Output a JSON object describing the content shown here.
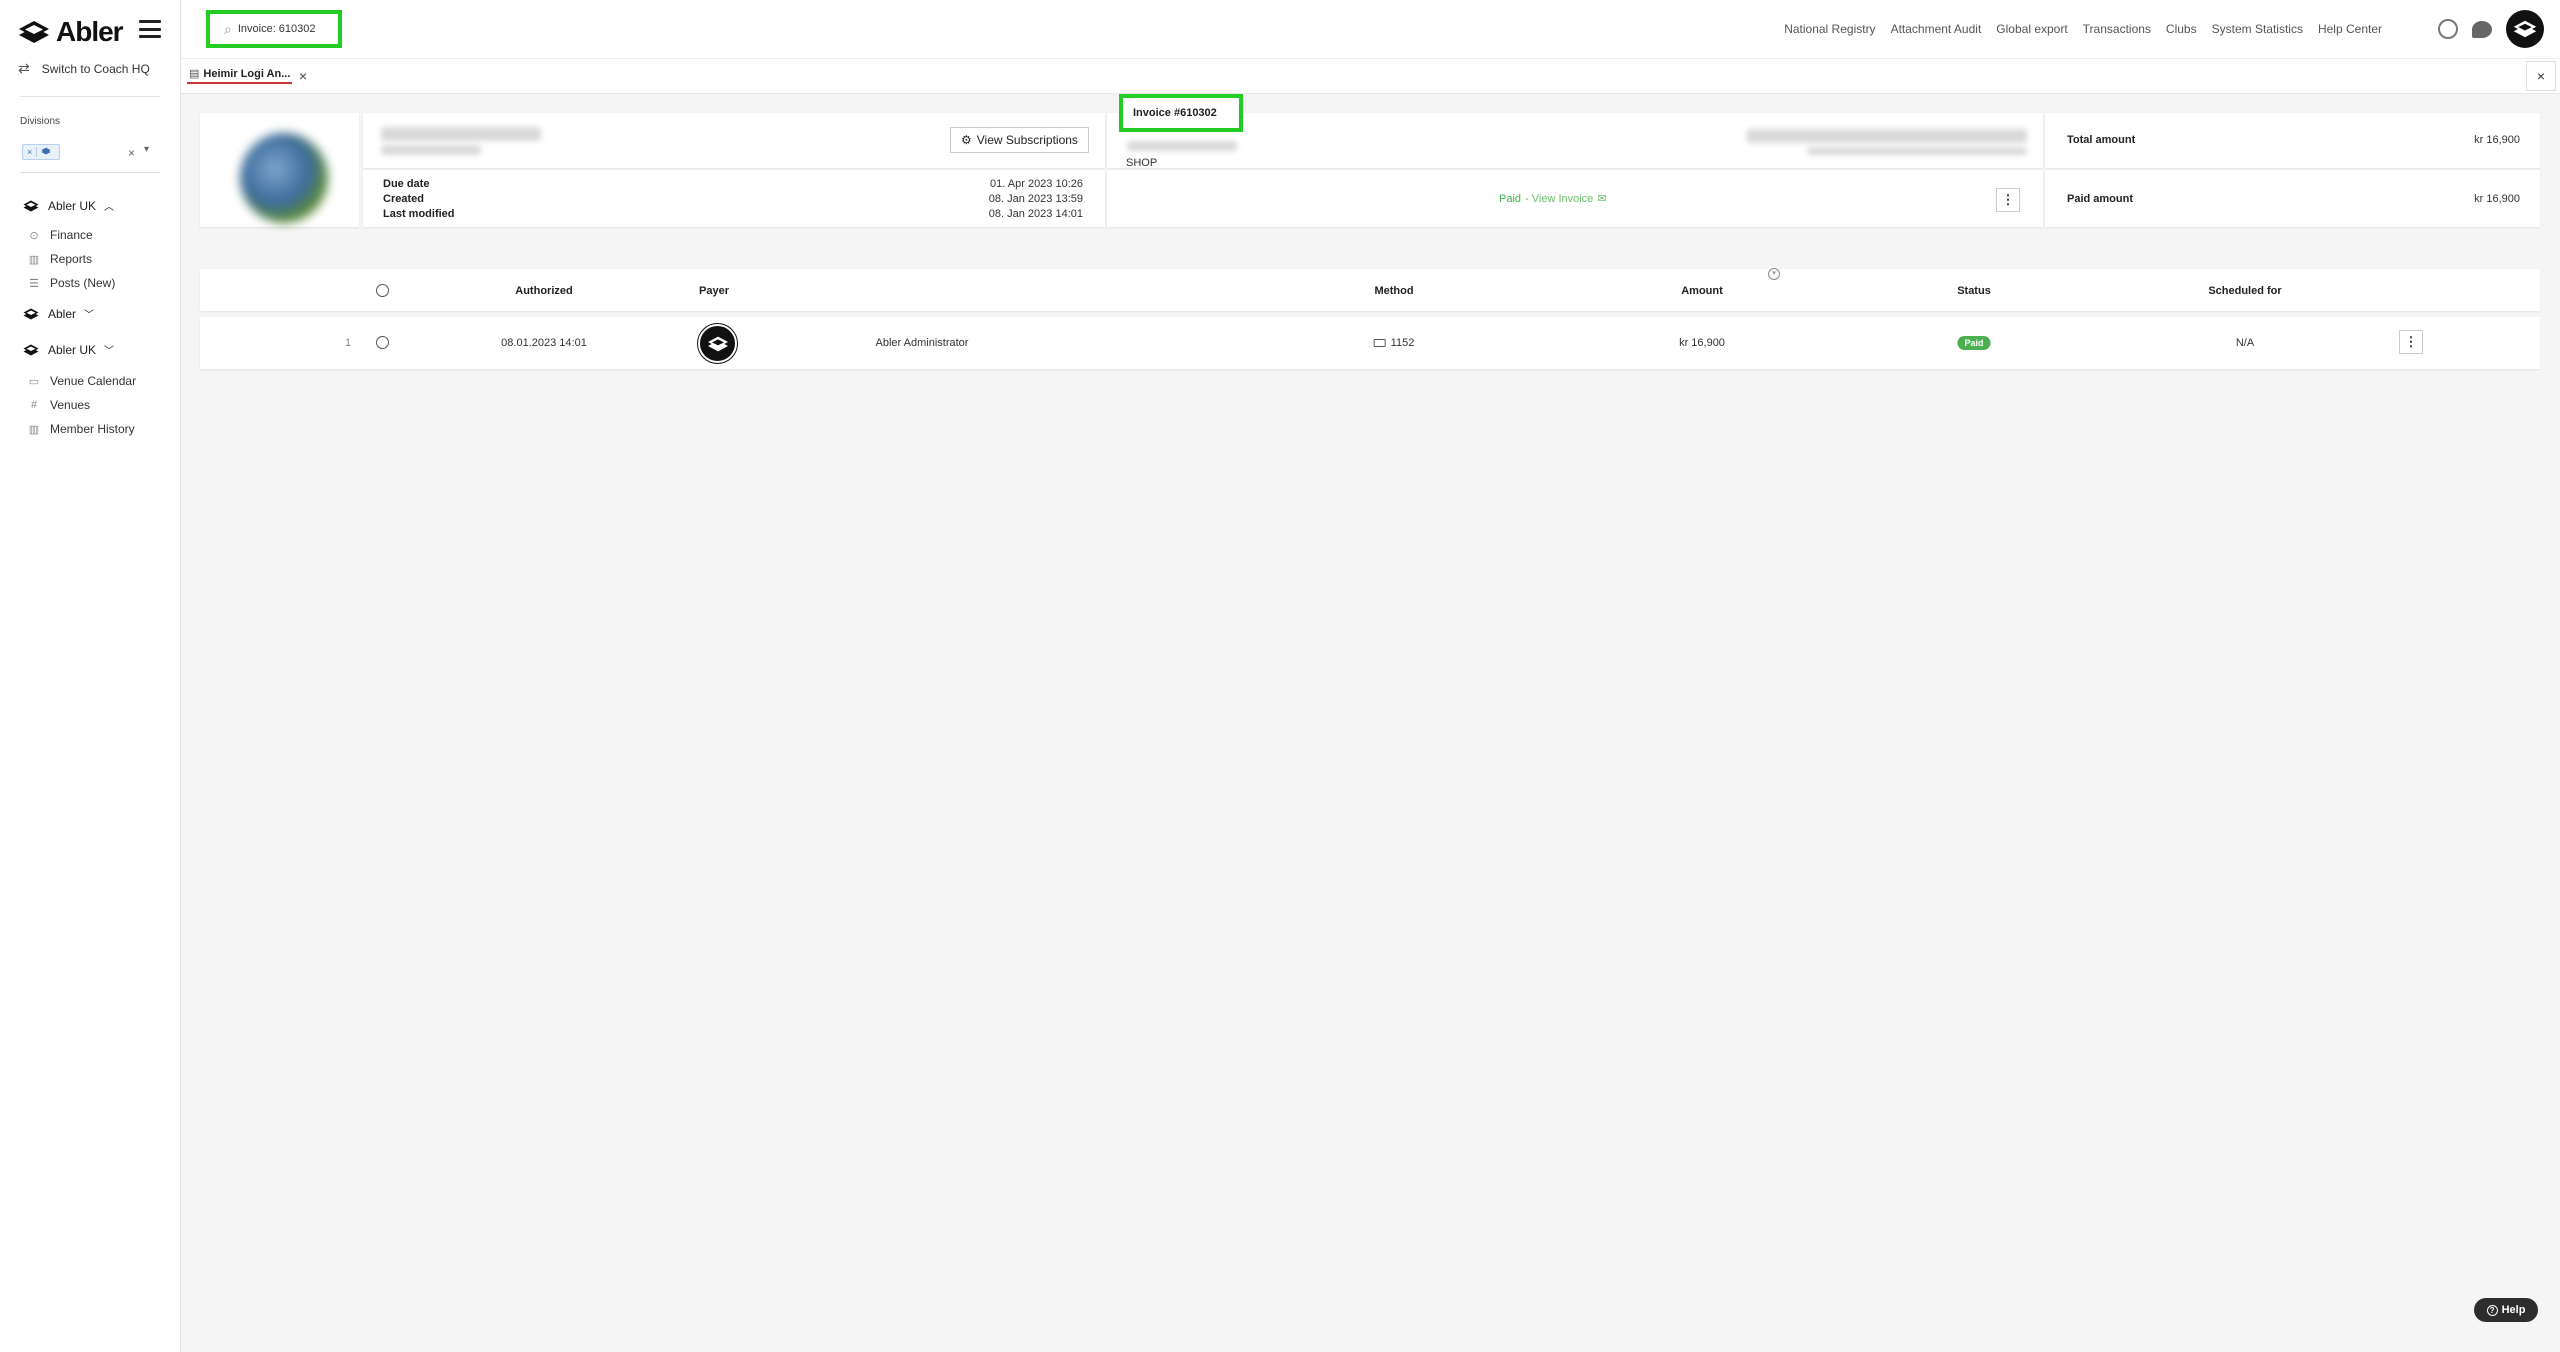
{
  "brand": {
    "name": "Abler"
  },
  "sidebar": {
    "switch_label": "Switch to Coach HQ",
    "divisions_label": "Divisions",
    "division_chip_clear": "×",
    "groups": [
      {
        "label": "Abler UK",
        "caret": "⌃"
      },
      {
        "label": "Abler",
        "caret": "⌄"
      },
      {
        "label": "Abler UK",
        "caret": "⌄"
      }
    ],
    "items_group1": [
      {
        "label": "Finance",
        "icon": "dollar-icon"
      },
      {
        "label": "Reports",
        "icon": "bar-chart-icon"
      },
      {
        "label": "Posts (New)",
        "icon": "posts-icon"
      }
    ],
    "items_group3": [
      {
        "label": "Venue Calendar",
        "icon": "calendar-icon"
      },
      {
        "label": "Venues",
        "icon": "hash-icon"
      },
      {
        "label": "Member History",
        "icon": "bar-chart-icon"
      }
    ]
  },
  "search": {
    "value": "Invoice: 610302"
  },
  "topnav": {
    "links": [
      "National Registry",
      "Attachment Audit",
      "Global export",
      "Transactions",
      "Clubs",
      "System Statistics",
      "Help Center"
    ]
  },
  "tabs": [
    {
      "label": "Heimir Logi An..."
    }
  ],
  "invoice": {
    "title": "Invoice #610302",
    "source": "SHOP",
    "view_subscriptions": "View Subscriptions",
    "due_date_label": "Due date",
    "due_date": "01. Apr 2023 10:26",
    "created_label": "Created",
    "created": "08. Jan 2023 13:59",
    "modified_label": "Last modified",
    "modified": "08. Jan 2023 14:01",
    "status": "Paid",
    "view_invoice": "- View Invoice",
    "total_label": "Total amount",
    "total": "kr 16,900",
    "paid_label": "Paid amount",
    "paid": "kr 16,900"
  },
  "transactions": {
    "columns": [
      "Authorized",
      "Payer",
      "Method",
      "Amount",
      "Status",
      "Scheduled for"
    ],
    "rows": [
      {
        "index": "1",
        "authorized": "08.01.2023 14:01",
        "payer": "Abler Administrator",
        "method": "1152",
        "amount": "kr 16,900",
        "status": "Paid",
        "scheduled": "N/A"
      }
    ]
  },
  "help": {
    "label": "Help"
  },
  "colors": {
    "highlight": "#22cc22",
    "paid": "#4caf50",
    "accent": "#111111"
  }
}
